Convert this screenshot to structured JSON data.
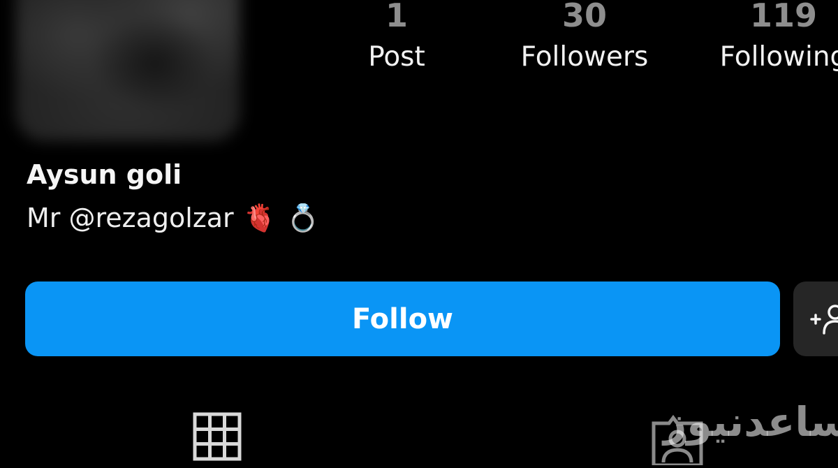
{
  "profile": {
    "display_name": "Aysun goli",
    "bio_text": "Mr @rezagolzar",
    "bio_emojis": [
      "🫀",
      "💍"
    ]
  },
  "stats": {
    "posts": {
      "count": "1",
      "label": "Post"
    },
    "followers": {
      "count": "30",
      "label": "Followers"
    },
    "following": {
      "count": "119",
      "label": "Following"
    }
  },
  "actions": {
    "follow_label": "Follow",
    "suggest_icon": "add-person-icon"
  },
  "tabs": [
    {
      "icon": "grid-icon"
    },
    {
      "icon": "tagged-person-icon"
    }
  ],
  "watermark": "ساعدنیوز",
  "colors": {
    "background": "#000000",
    "follow_button": "#0a95f5",
    "secondary_button": "#262626",
    "stat_count": "#8e8e8e"
  }
}
